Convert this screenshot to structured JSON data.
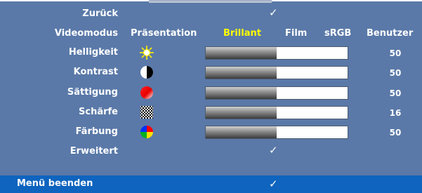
{
  "menu": {
    "back": {
      "label": "Zurück",
      "check": "✓"
    },
    "video_mode": {
      "label": "Videomodus",
      "options": [
        "Präsentation",
        "Brillant",
        "Film",
        "sRGB",
        "Benutzer"
      ],
      "selected": "Brillant"
    },
    "brightness": {
      "label": "Helligkeit",
      "icon": "sun-icon",
      "value": "50",
      "level": 0.5
    },
    "contrast": {
      "label": "Kontrast",
      "icon": "contrast-icon",
      "value": "50",
      "level": 0.5
    },
    "saturation": {
      "label": "Sättigung",
      "icon": "saturation-icon",
      "value": "50",
      "level": 0.5
    },
    "sharpness": {
      "label": "Schärfe",
      "icon": "sharpness-icon",
      "value": "16",
      "level": 0.5
    },
    "tint": {
      "label": "Färbung",
      "icon": "tint-icon",
      "value": "50",
      "level": 0.5
    },
    "advanced": {
      "label": "Erweitert",
      "check": "✓"
    }
  },
  "footer": {
    "exit_label": "Menü beenden",
    "check": "✓"
  },
  "colors": {
    "panel": "#5a79a8",
    "footer": "#0e64be",
    "selected_text": "#ffff00",
    "text": "#ffffff"
  }
}
